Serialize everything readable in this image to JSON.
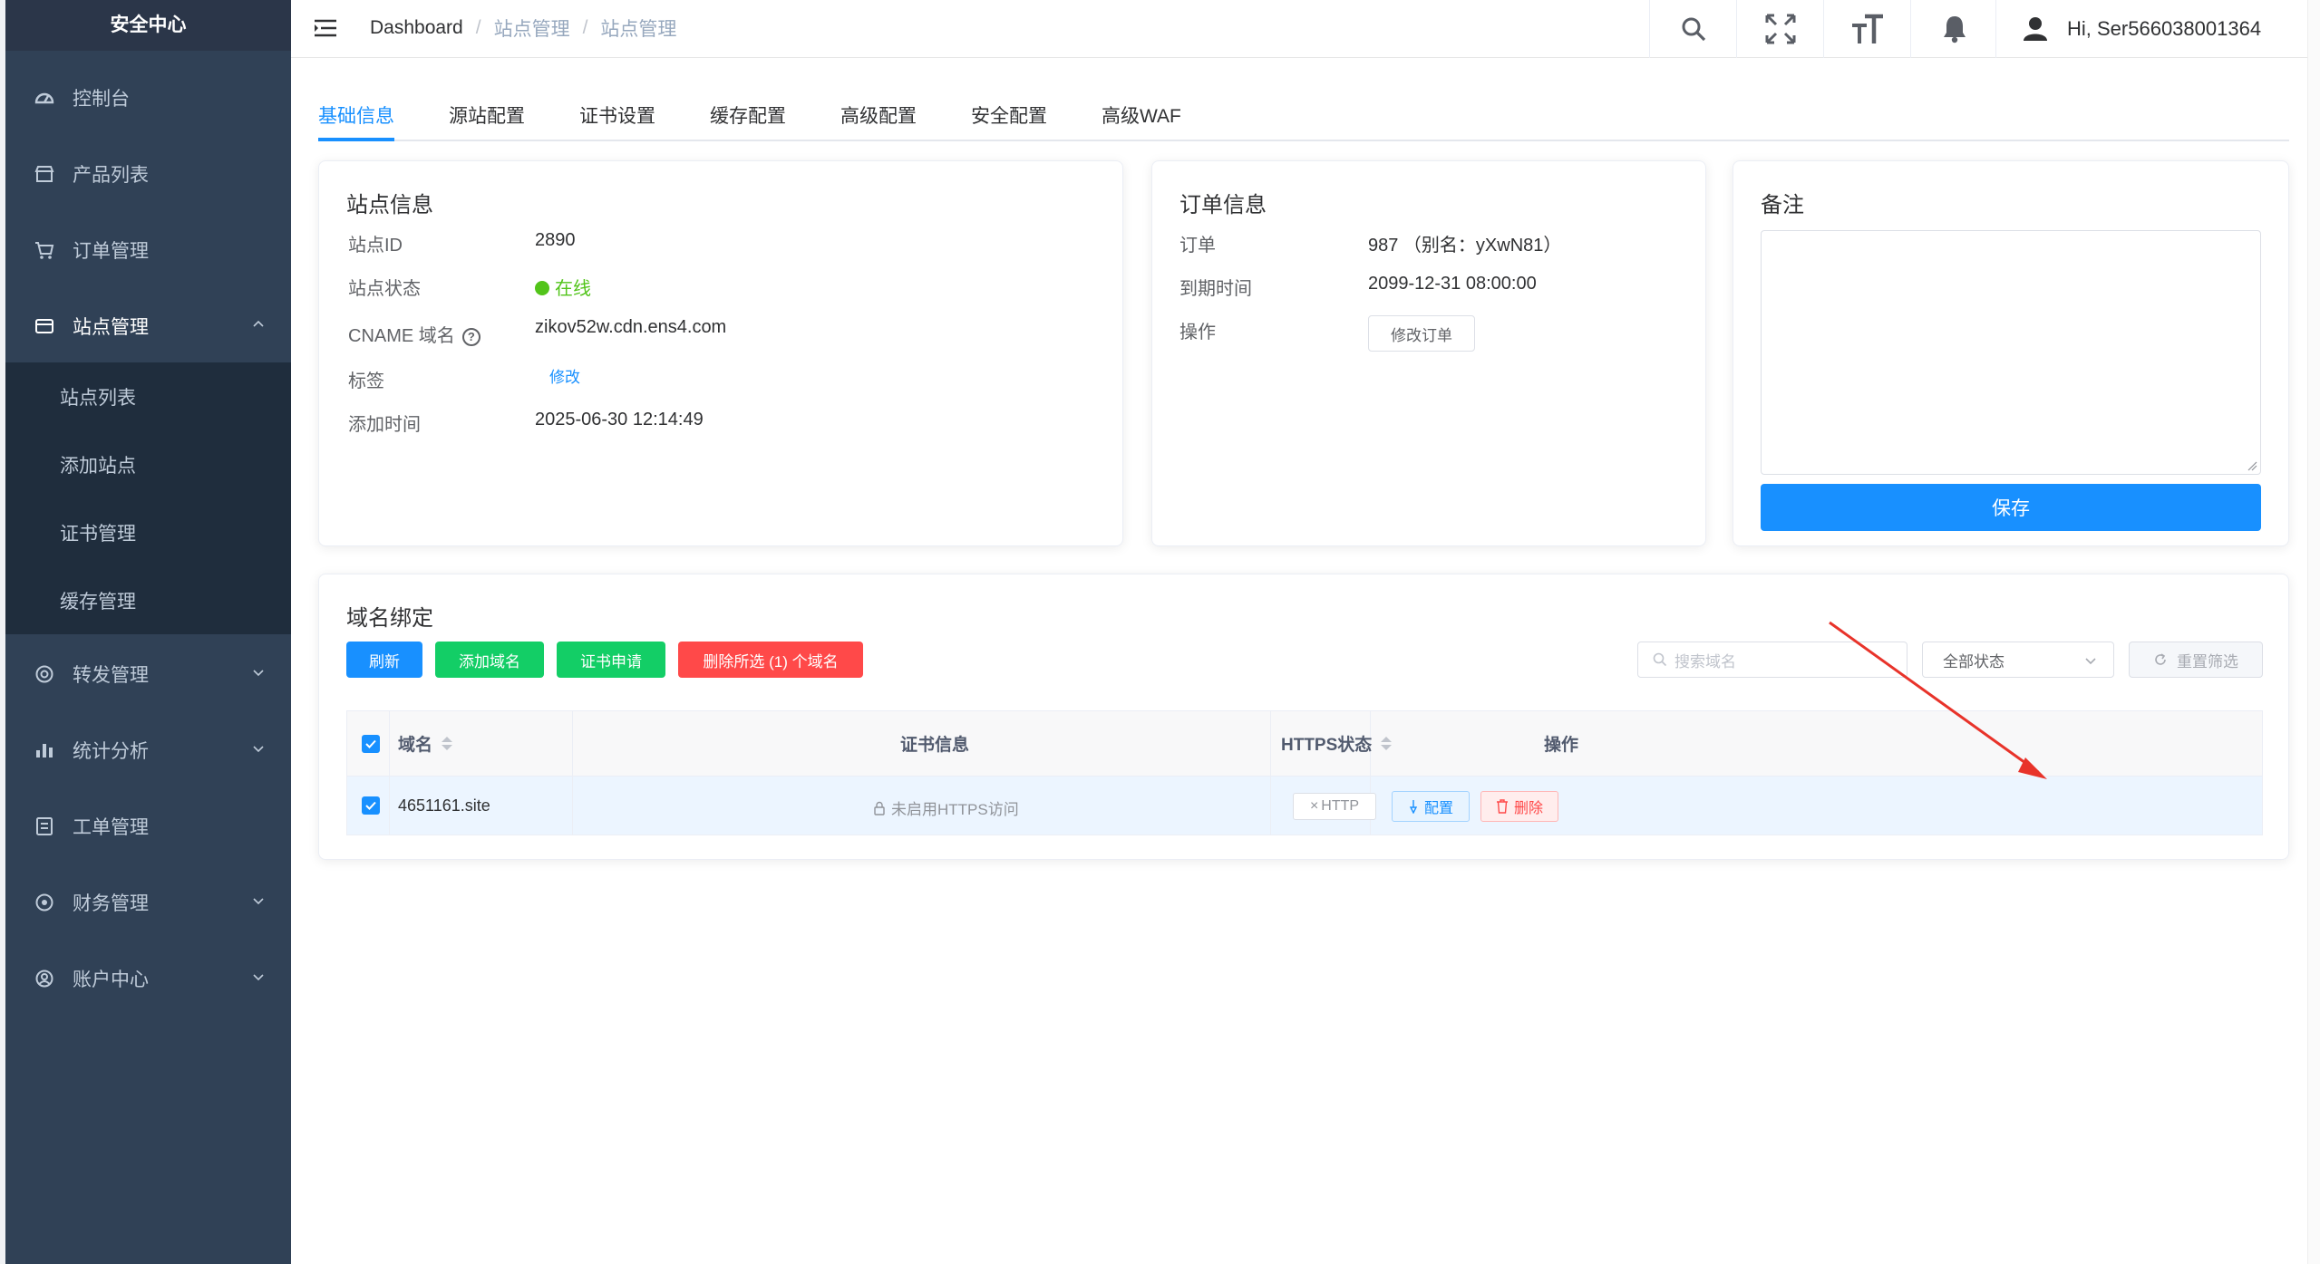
{
  "sidebar": {
    "logo": "安全中心",
    "items": [
      {
        "label": "控制台",
        "icon": "dashboard-icon"
      },
      {
        "label": "产品列表",
        "icon": "shop-icon"
      },
      {
        "label": "订单管理",
        "icon": "cart-icon"
      },
      {
        "label": "站点管理",
        "icon": "site-icon"
      },
      {
        "label": "转发管理",
        "icon": "forward-icon"
      },
      {
        "label": "统计分析",
        "icon": "chart-icon"
      },
      {
        "label": "工单管理",
        "icon": "ticket-icon"
      },
      {
        "label": "财务管理",
        "icon": "finance-icon"
      },
      {
        "label": "账户中心",
        "icon": "account-icon"
      }
    ],
    "sub_items": [
      {
        "label": "站点列表"
      },
      {
        "label": "添加站点"
      },
      {
        "label": "证书管理"
      },
      {
        "label": "缓存管理"
      }
    ]
  },
  "header": {
    "breadcrumb": [
      "Dashboard",
      "站点管理",
      "站点管理"
    ],
    "user": "Hi, Ser566038001364"
  },
  "tabs": [
    {
      "label": "基础信息",
      "active": true
    },
    {
      "label": "源站配置"
    },
    {
      "label": "证书设置"
    },
    {
      "label": "缓存配置"
    },
    {
      "label": "高级配置"
    },
    {
      "label": "安全配置"
    },
    {
      "label": "高级WAF"
    }
  ],
  "site_info": {
    "title": "站点信息",
    "id_label": "站点ID",
    "id_value": "2890",
    "status_label": "站点状态",
    "status_value": "在线",
    "cname_label": "CNAME 域名",
    "cname_value": "zikov52w.cdn.ens4.com",
    "tag_label": "标签",
    "tag_edit": "修改",
    "added_label": "添加时间",
    "added_value": "2025-06-30 12:14:49"
  },
  "order_info": {
    "title": "订单信息",
    "order_label": "订单",
    "order_value": "987 （别名：yXwN81）",
    "expire_label": "到期时间",
    "expire_value": "2099-12-31 08:00:00",
    "action_label": "操作",
    "modify_button": "修改订单"
  },
  "remark": {
    "title": "备注",
    "value": "",
    "save_button": "保存"
  },
  "domain_binding": {
    "title": "域名绑定",
    "buttons": {
      "refresh": "刷新",
      "add_domain": "添加域名",
      "cert_apply": "证书申请",
      "delete_selected": "删除所选 (1) 个域名"
    },
    "search_placeholder": "搜索域名",
    "status_filter": "全部状态",
    "reset_filter": "重置筛选",
    "columns": [
      "域名",
      "证书信息",
      "HTTPS状态",
      "操作"
    ],
    "rows": [
      {
        "domain": "4651161.site",
        "cert_info": "未启用HTTPS访问",
        "https_status": "HTTP",
        "config_button": "配置",
        "delete_button": "删除"
      }
    ]
  },
  "colors": {
    "sidebar_bg": "#304156",
    "submenu_bg": "#1f2d3d",
    "primary": "#1890ff",
    "success": "#13ce66",
    "danger": "#ff4949",
    "online": "#52c41a",
    "annotation_arrow": "#e8332a"
  }
}
